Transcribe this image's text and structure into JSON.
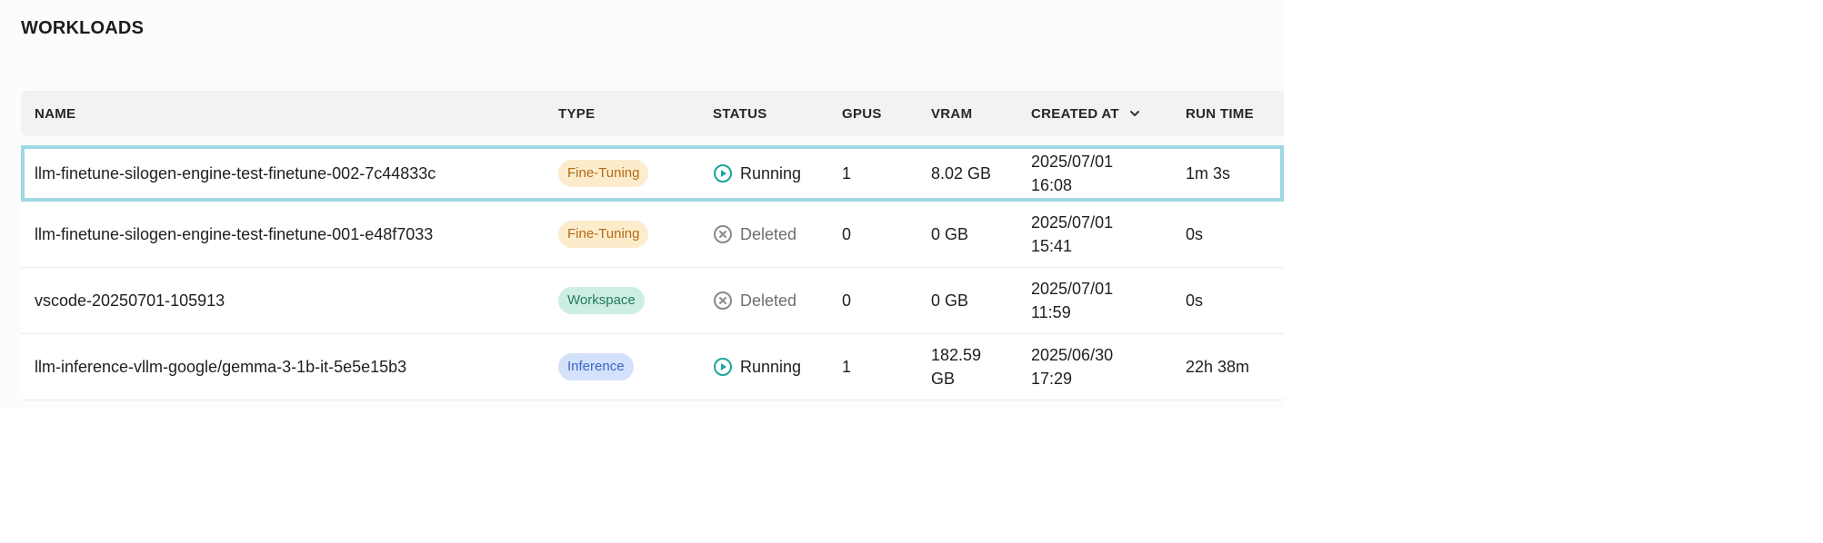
{
  "title": "WORKLOADS",
  "columns": {
    "name": "NAME",
    "type": "TYPE",
    "status": "STATUS",
    "gpus": "GPUS",
    "vram": "VRAM",
    "created_at": "CREATED AT",
    "run_time": "RUN TIME"
  },
  "sort_icon": "chevron-down-icon",
  "rows": [
    {
      "name": "llm-finetune-silogen-engine-test-finetune-002-7c44833c",
      "type": "Fine-Tuning",
      "status": "Running",
      "status_icon": "play-circle-icon",
      "gpus": "1",
      "vram": "8.02 GB",
      "created_date": "2025/07/01",
      "created_time": "16:08",
      "run_time": "1m 3s",
      "selected": true
    },
    {
      "name": "llm-finetune-silogen-engine-test-finetune-001-e48f7033",
      "type": "Fine-Tuning",
      "status": "Deleted",
      "status_icon": "x-circle-icon",
      "gpus": "0",
      "vram": "0 GB",
      "created_date": "2025/07/01",
      "created_time": "15:41",
      "run_time": "0s"
    },
    {
      "name": "vscode-20250701-105913",
      "type": "Workspace",
      "status": "Deleted",
      "status_icon": "x-circle-icon",
      "gpus": "0",
      "vram": "0 GB",
      "created_date": "2025/07/01",
      "created_time": "11:59",
      "run_time": "0s"
    },
    {
      "name": "llm-inference-vllm-google/gemma-3-1b-it-5e5e15b3",
      "type": "Inference",
      "status": "Running",
      "status_icon": "play-circle-icon",
      "gpus": "1",
      "vram_line1": "182.59",
      "vram_line2": "GB",
      "created_date": "2025/06/30",
      "created_time": "17:29",
      "run_time": "22h 38m"
    }
  ],
  "colors": {
    "running": "#1aa59a",
    "deleted": "#8a8a8a",
    "selection_outline": "#9ed8e4"
  }
}
